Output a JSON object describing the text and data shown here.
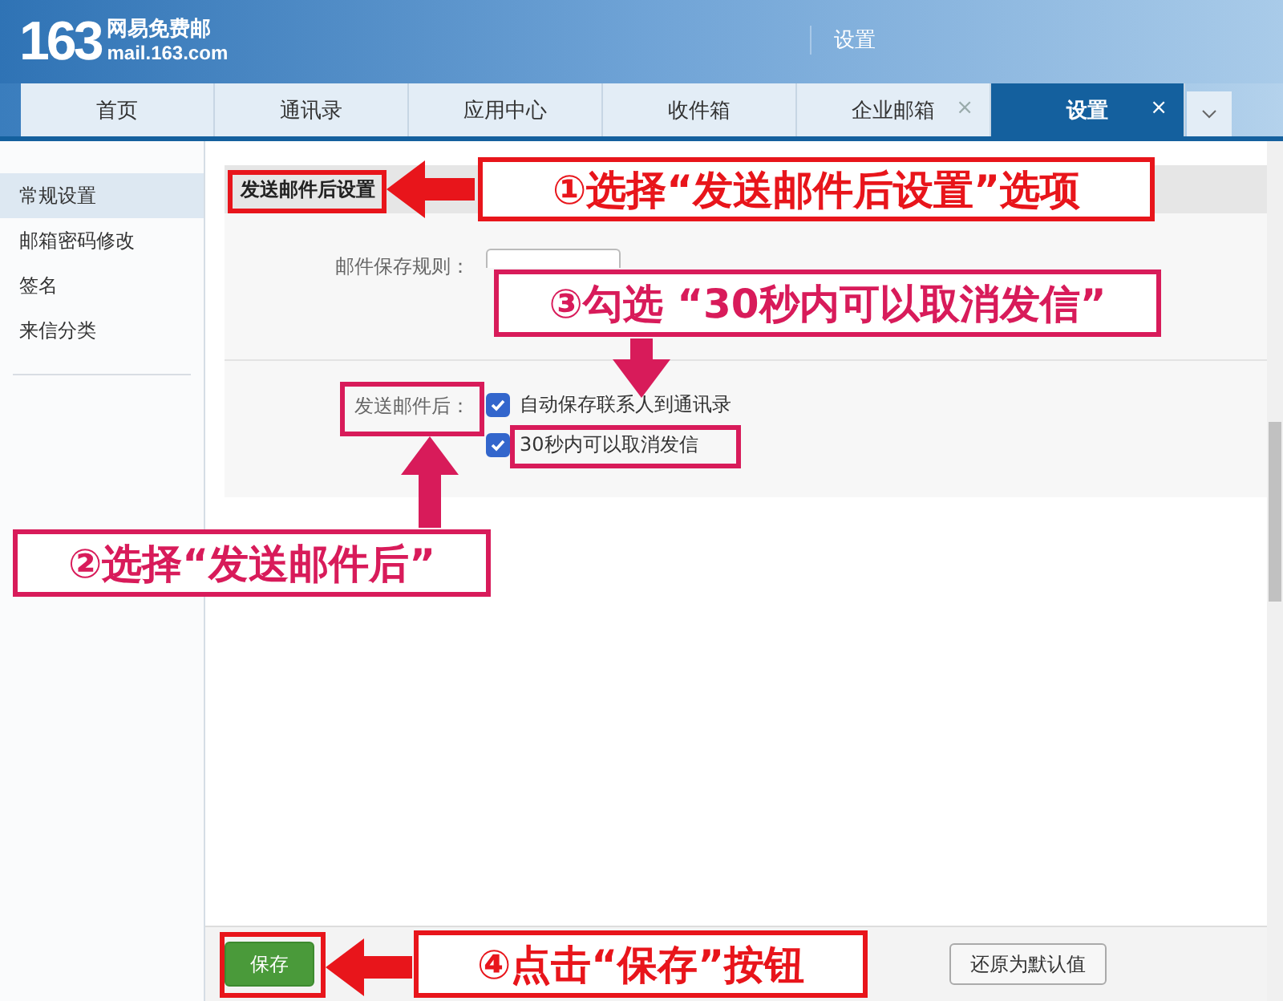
{
  "header": {
    "logo_number": "163",
    "logo_name": "网易免费邮",
    "logo_domain": "mail.163.com",
    "title": "设置"
  },
  "tabs": [
    {
      "label": "首页",
      "selected": false,
      "closable": false
    },
    {
      "label": "通讯录",
      "selected": false,
      "closable": false
    },
    {
      "label": "应用中心",
      "selected": false,
      "closable": false
    },
    {
      "label": "收件箱",
      "selected": false,
      "closable": false
    },
    {
      "label": "企业邮箱",
      "selected": false,
      "closable": true
    },
    {
      "label": "设置",
      "selected": true,
      "closable": true
    }
  ],
  "tab_close": "×",
  "sidebar": {
    "items": [
      {
        "label": "常规设置",
        "selected": true
      },
      {
        "label": "邮箱密码修改",
        "selected": false
      },
      {
        "label": "签名",
        "selected": false
      },
      {
        "label": "来信分类",
        "selected": false
      }
    ]
  },
  "section": {
    "title": "发送邮件后设置",
    "rows": [
      {
        "label": "邮件保存规则：",
        "kind": "dropdown"
      },
      {
        "label": "发送邮件后：",
        "kind": "checkboxes",
        "options": [
          {
            "label": "自动保存联系人到通讯录",
            "checked": true
          },
          {
            "label": "30秒内可以取消发信",
            "checked": true
          }
        ]
      }
    ]
  },
  "footer": {
    "save": "保存",
    "reset": "还原为默认值"
  },
  "annotations": [
    {
      "text": "①选择“发送邮件后设置”选项",
      "color": "#e8151b"
    },
    {
      "text": "③勾选 “30秒内可以取消发信”",
      "color": "#d81b5a"
    },
    {
      "text": "②选择“发送邮件后”",
      "color": "#d81b5a"
    },
    {
      "text": "④点击“保存”按钮",
      "color": "#e8151b"
    }
  ]
}
